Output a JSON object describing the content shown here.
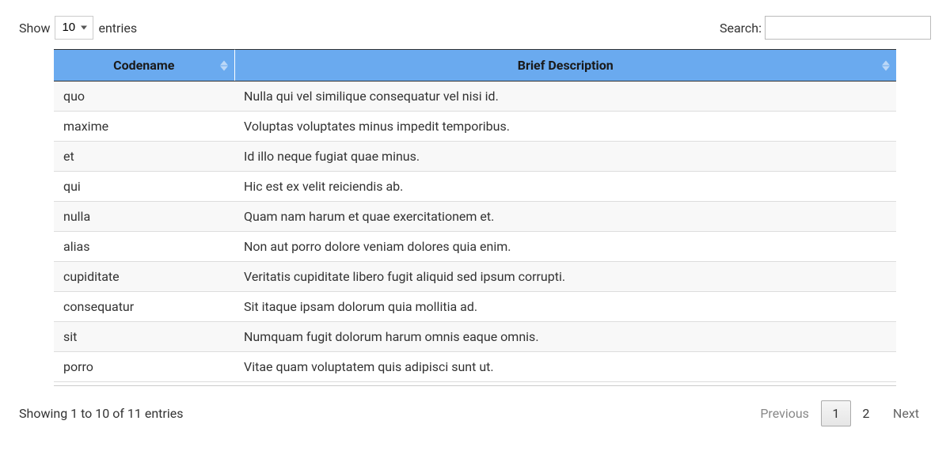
{
  "lengthControl": {
    "prefix": "Show",
    "suffix": "entries",
    "selected": "10"
  },
  "searchControl": {
    "label": "Search:"
  },
  "table": {
    "headers": [
      "Codename",
      "Brief Description"
    ],
    "rows": [
      {
        "codename": "quo",
        "description": "Nulla qui vel similique consequatur vel nisi id."
      },
      {
        "codename": "maxime",
        "description": "Voluptas voluptates minus impedit temporibus."
      },
      {
        "codename": "et",
        "description": "Id illo neque fugiat quae minus."
      },
      {
        "codename": "qui",
        "description": "Hic est ex velit reiciendis ab."
      },
      {
        "codename": "nulla",
        "description": "Quam nam harum et quae exercitationem et."
      },
      {
        "codename": "alias",
        "description": "Non aut porro dolore veniam dolores quia enim."
      },
      {
        "codename": "cupiditate",
        "description": "Veritatis cupiditate libero fugit aliquid sed ipsum corrupti."
      },
      {
        "codename": "consequatur",
        "description": "Sit itaque ipsam dolorum quia mollitia ad."
      },
      {
        "codename": "sit",
        "description": "Numquam fugit dolorum harum omnis eaque omnis."
      },
      {
        "codename": "porro",
        "description": "Vitae quam voluptatem quis adipisci sunt ut."
      }
    ]
  },
  "info": "Showing 1 to 10 of 11 entries",
  "pagination": {
    "previous": "Previous",
    "next": "Next",
    "pages": [
      "1",
      "2"
    ],
    "active": "1"
  }
}
